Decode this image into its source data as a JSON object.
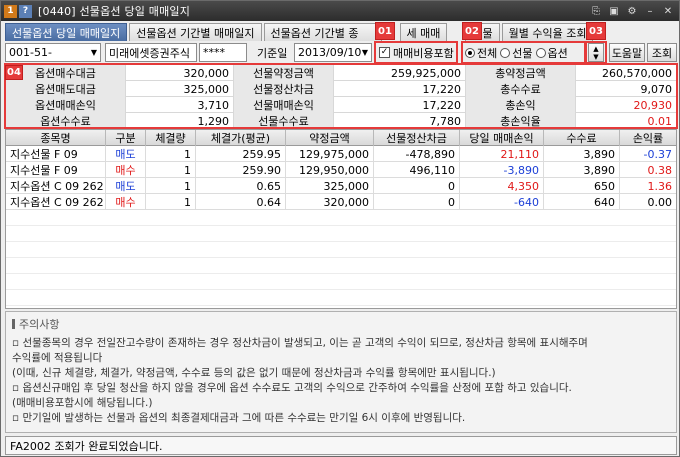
{
  "window": {
    "badge1": "1",
    "badge2": "?",
    "title": "[0440] 선물옵션 당일 매매일지"
  },
  "tabs": [
    {
      "label": "선물옵션 당일 매매일지",
      "active": true
    },
    {
      "label": "선물옵션 기간별 매매일지"
    },
    {
      "label": "선물옵션 기간별 종"
    },
    {
      "label": "세 매매"
    },
    {
      "label": "선물"
    },
    {
      "label": "월별 수익율 조회"
    }
  ],
  "markers": {
    "m1": "01",
    "m2": "02",
    "m3": "03",
    "m4": "04"
  },
  "search": {
    "account": "001-51-",
    "account_name": "미래에셋증권주식",
    "password": "****",
    "date_label": "기준일",
    "date_value": "2013/09/10",
    "include_fee_label": "매매비용포함",
    "radio_all": "전체",
    "radio_futures": "선물",
    "radio_options": "옵션",
    "help_button": "도움말",
    "query_button": "조회"
  },
  "summary": {
    "rows": [
      [
        {
          "k": "옵션매수대금",
          "v": "320,000"
        },
        {
          "k": "선물약정금액",
          "v": "259,925,000"
        },
        {
          "k": "총약정금액",
          "v": "260,570,000"
        }
      ],
      [
        {
          "k": "옵션매도대금",
          "v": "325,000"
        },
        {
          "k": "선물정산차금",
          "v": "17,220"
        },
        {
          "k": "총수수료",
          "v": "9,070"
        }
      ],
      [
        {
          "k": "옵션매매손익",
          "v": "3,710"
        },
        {
          "k": "선물매매손익",
          "v": "17,220"
        },
        {
          "k": "총손익",
          "v": "20,930",
          "red": true
        }
      ],
      [
        {
          "k": "옵션수수료",
          "v": "1,290"
        },
        {
          "k": "선물수수료",
          "v": "7,780"
        },
        {
          "k": "총손익율",
          "v": "0.01",
          "red": true
        }
      ]
    ]
  },
  "table": {
    "headers": [
      "종목명",
      "구분",
      "체결량",
      "체결가(평균)",
      "약정금액",
      "선물정산차금",
      "당일 매매손익",
      "수수료",
      "손익률"
    ],
    "rows": [
      {
        "name": "지수선물 F 09",
        "side": "매도",
        "side_color": "#1c3fd6",
        "qty": "1",
        "price": "259.95",
        "amount": "129,975,000",
        "settle": "-478,890",
        "pnl": "21,110",
        "pnl_color": "#e01818",
        "fee": "3,890",
        "rate": "-0.37",
        "rate_color": "#1c3fd6"
      },
      {
        "name": "지수선물 F 09",
        "side": "매수",
        "side_color": "#e01818",
        "qty": "1",
        "price": "259.90",
        "amount": "129,950,000",
        "settle": "496,110",
        "pnl": "-3,890",
        "pnl_color": "#1c3fd6",
        "fee": "3,890",
        "rate": "0.38",
        "rate_color": "#e01818"
      },
      {
        "name": "지수옵션 C 09 262",
        "side": "매도",
        "side_color": "#1c3fd6",
        "qty": "1",
        "price": "0.65",
        "amount": "325,000",
        "settle": "0",
        "pnl": "4,350",
        "pnl_color": "#e01818",
        "fee": "650",
        "rate": "1.36",
        "rate_color": "#e01818"
      },
      {
        "name": "지수옵션 C 09 262",
        "side": "매수",
        "side_color": "#e01818",
        "qty": "1",
        "price": "0.64",
        "amount": "320,000",
        "settle": "0",
        "pnl": "-640",
        "pnl_color": "#1c3fd6",
        "fee": "640",
        "rate": "0.00",
        "rate_color": "#000000"
      }
    ]
  },
  "notice": {
    "title": "주의사항",
    "lines": [
      "▫ 선물종목의 경우 전일잔고수량이 존재하는 경우 정산차금이 발생되고, 이는 곧 고객의 수익이 되므로, 정산차금 항목에 표시해주며",
      "   수익률에 적용됩니다",
      "   (이때, 신규 체결량, 체결가, 약정금액, 수수료 등의 값은 없기 때문에 정산차금과 수익률 항목에만 표시됩니다.)",
      "▫ 옵션신규매입 후 당일 청산을 하지 않을 경우에 옵션 수수료도 고객의 수익으로 간주하여 수익률을 산정에 포함 하고 있습니다.",
      "   (매매비용포함시에 해당됩니다.)",
      "▫ 만기일에 발생하는 선물과 옵션의 최종결제대금과 그에 따른 수수료는 만기일 6시 이후에 반영됩니다."
    ]
  },
  "status": "FA2002 조회가 완료되었습니다."
}
